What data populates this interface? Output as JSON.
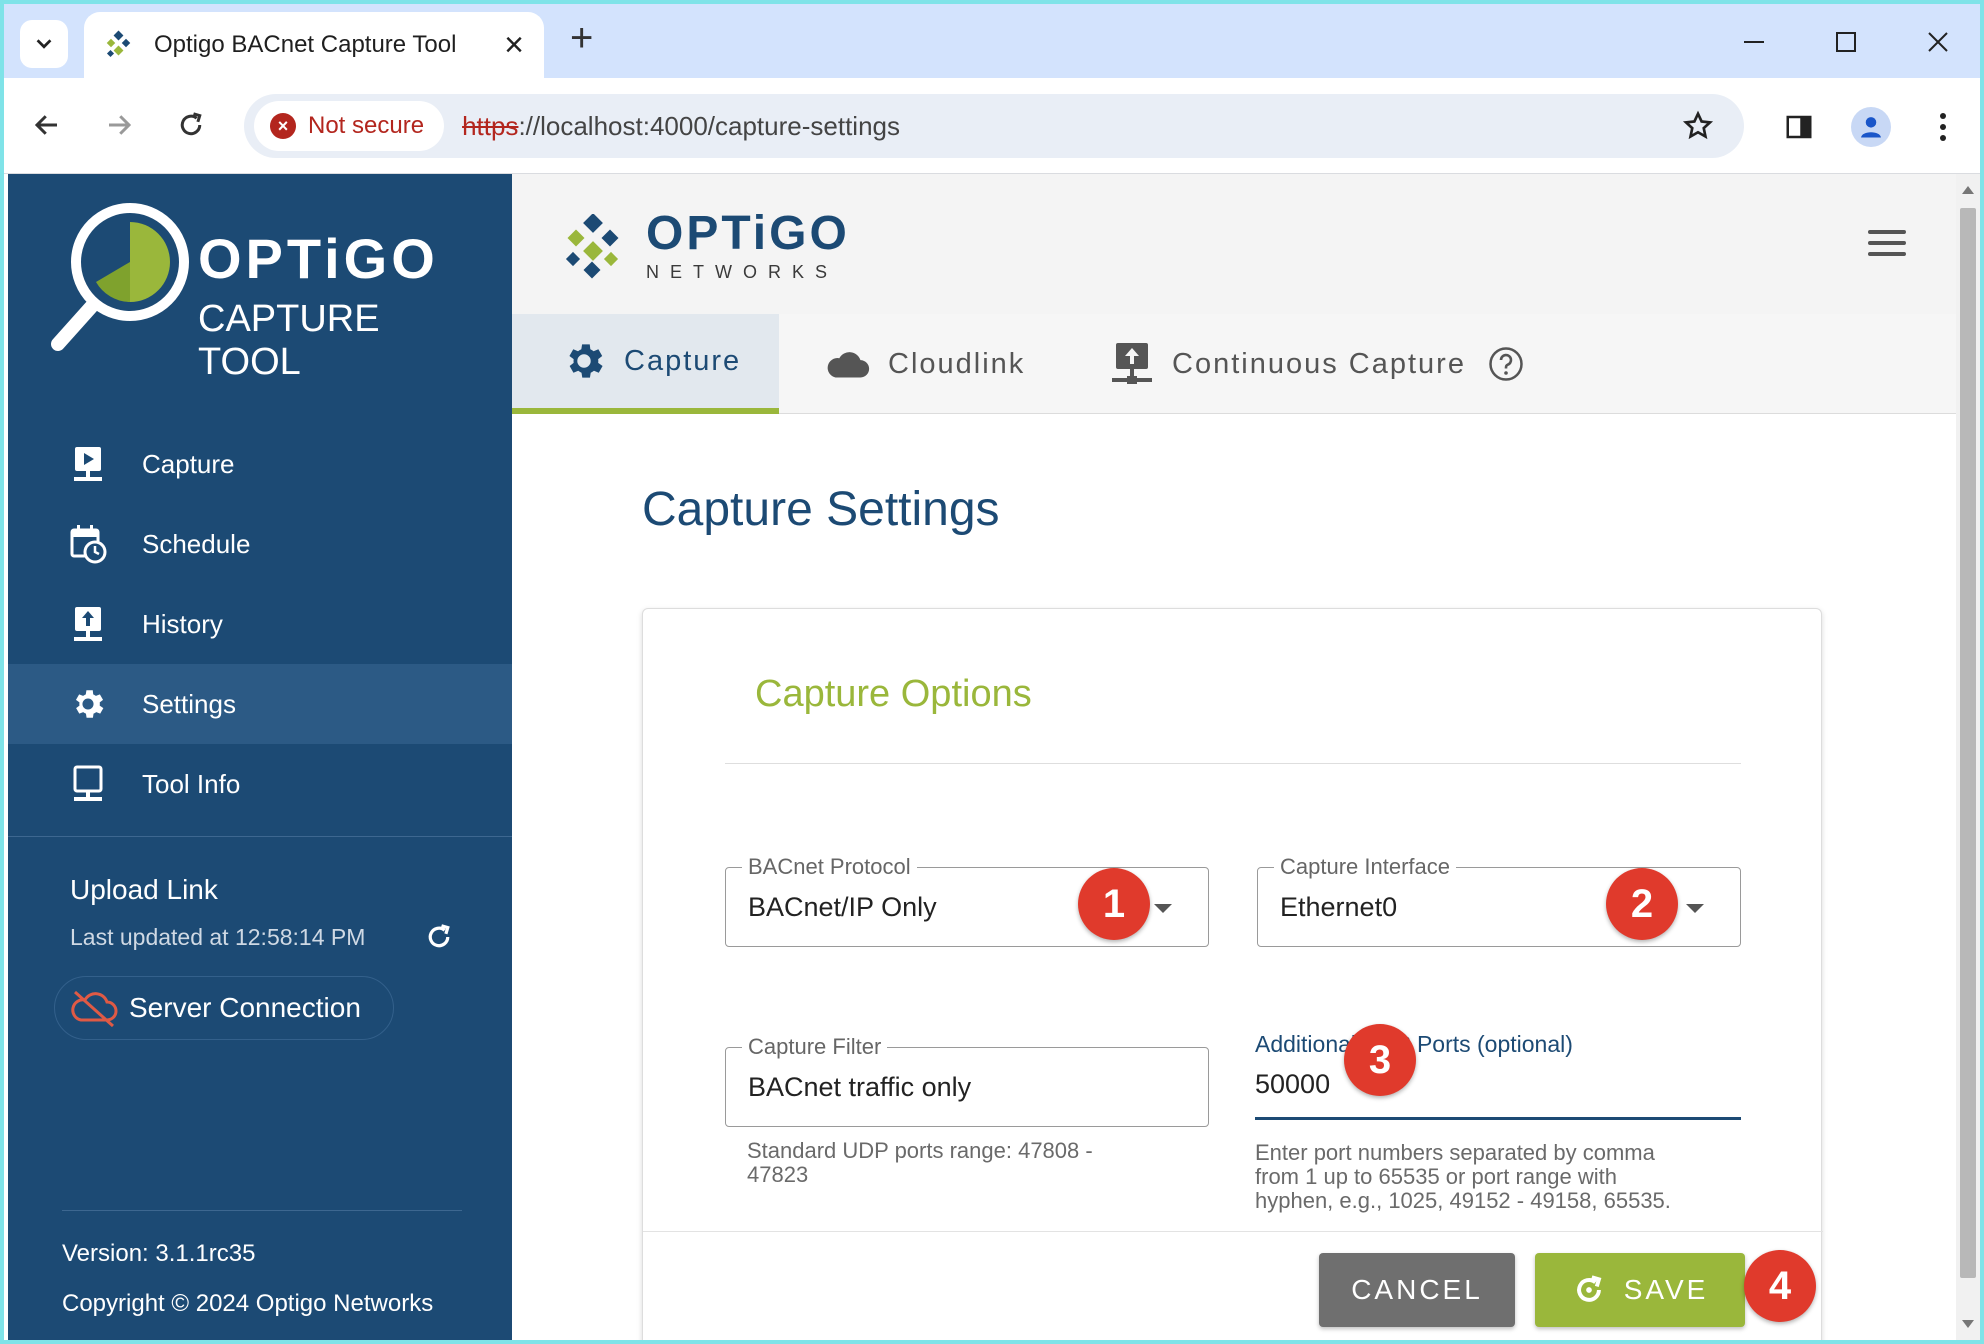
{
  "browser": {
    "tab_title": "Optigo BACnet Capture Tool",
    "not_secure": "Not secure",
    "url_scheme": "https",
    "url_rest": "://localhost:4000/capture-settings"
  },
  "sidebar": {
    "logo_line1": "OPTiGO",
    "logo_line2": "CAPTURE TOOL",
    "items": [
      {
        "label": "Capture",
        "icon": "monitor-play-icon"
      },
      {
        "label": "Schedule",
        "icon": "calendar-clock-icon"
      },
      {
        "label": "History",
        "icon": "monitor-upload-icon"
      },
      {
        "label": "Settings",
        "icon": "gear-icon",
        "active": true
      },
      {
        "label": "Tool Info",
        "icon": "monitor-icon"
      }
    ],
    "upload_title": "Upload Link",
    "upload_updated": "Last updated at 12:58:14 PM",
    "server_connection": "Server Connection",
    "version": "Version: 3.1.1rc35",
    "copyright": "Copyright © 2024 Optigo Networks"
  },
  "header": {
    "brand_line1": "OPTiGO",
    "brand_line2": "NETWORKS"
  },
  "tabs": [
    {
      "label": "Capture",
      "icon": "gear-icon",
      "active": true
    },
    {
      "label": "Cloudlink",
      "icon": "cloud-icon"
    },
    {
      "label": "Continuous Capture",
      "icon": "network-upload-icon"
    }
  ],
  "main": {
    "page_title": "Capture Settings",
    "card_title": "Capture Options",
    "protocol": {
      "label": "BACnet Protocol",
      "value": "BACnet/IP Only"
    },
    "interface": {
      "label": "Capture Interface",
      "value": "Ethernet0"
    },
    "filter": {
      "label": "Capture Filter",
      "value": "BACnet traffic only",
      "helper_1": "Standard UDP ports range: 47808 -",
      "helper_2": "47823"
    },
    "udp": {
      "label": "Additional UDP Ports (optional)",
      "value": "50000",
      "helper_1": "Enter port numbers separated by comma",
      "helper_2": "from 1 up to 65535 or port range with",
      "helper_3": "hyphen, e.g., 1025, 49152 - 49158, 65535."
    },
    "cancel_label": "CANCEL",
    "save_label": "SAVE"
  },
  "badges": [
    "1",
    "2",
    "3",
    "4"
  ],
  "colors": {
    "sidebar": "#1c4a74",
    "accent": "#9ab73b",
    "badge": "#e03a2c"
  }
}
